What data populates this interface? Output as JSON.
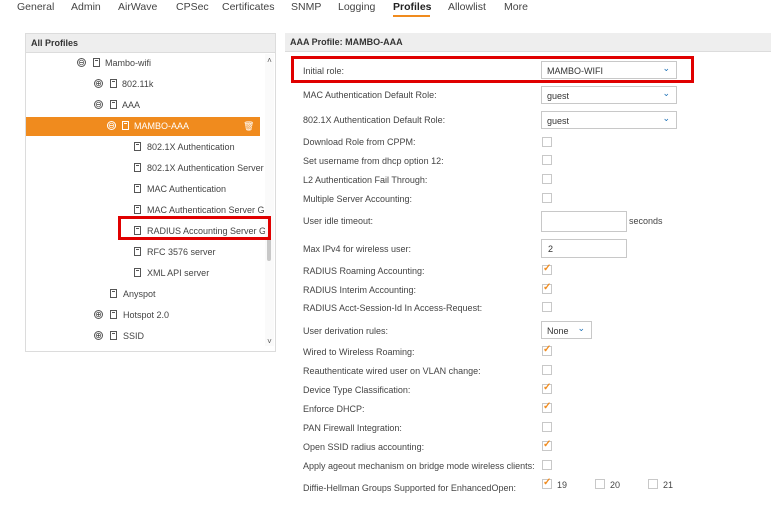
{
  "tabs": [
    "General",
    "Admin",
    "AirWave",
    "CPSec",
    "Certificates",
    "SNMP",
    "Logging",
    "Profiles",
    "Allowlist",
    "More"
  ],
  "active_tab": "Profiles",
  "left_panel": {
    "title": "All Profiles",
    "tree": [
      {
        "label": "Mambo-wifi",
        "control": "⊖"
      },
      {
        "label": "802.11k",
        "control": "⊕"
      },
      {
        "label": "AAA",
        "control": "⊖"
      },
      {
        "label": "MAMBO-AAA",
        "control": "⊖"
      },
      {
        "label": "802.1X Authentication"
      },
      {
        "label": "802.1X Authentication Server"
      },
      {
        "label": "MAC Authentication"
      },
      {
        "label": "MAC Authentication Server Gr"
      },
      {
        "label": "RADIUS Accounting Server Gr"
      },
      {
        "label": "RFC 3576 server"
      },
      {
        "label": "XML API server"
      },
      {
        "label": "Anyspot"
      },
      {
        "label": "Hotspot 2.0",
        "control": "⊕"
      },
      {
        "label": "SSID",
        "control": "⊕"
      }
    ],
    "trash_icon": "trash-icon",
    "scroll_up": "˄",
    "scroll_down": "˅"
  },
  "right_panel": {
    "title": "AAA Profile: MAMBO-AAA",
    "fields": [
      {
        "label": "Initial role:",
        "type": "select",
        "value": "MAMBO-WIFI"
      },
      {
        "label": "MAC Authentication Default Role:",
        "type": "select",
        "value": "guest"
      },
      {
        "label": "802.1X Authentication Default Role:",
        "type": "select",
        "value": "guest"
      },
      {
        "label": "Download Role from CPPM:",
        "type": "checkbox",
        "checked": false
      },
      {
        "label": "Set username from dhcp option 12:",
        "type": "checkbox",
        "checked": false
      },
      {
        "label": "L2 Authentication Fail Through:",
        "type": "checkbox",
        "checked": false
      },
      {
        "label": "Multiple Server Accounting:",
        "type": "checkbox",
        "checked": false
      },
      {
        "label": "User idle timeout:",
        "type": "text",
        "value": "",
        "suffix": "seconds"
      },
      {
        "label": "Max IPv4 for wireless user:",
        "type": "text",
        "value": "2"
      },
      {
        "label": "RADIUS Roaming Accounting:",
        "type": "checkbox",
        "checked": true
      },
      {
        "label": "RADIUS Interim Accounting:",
        "type": "checkbox",
        "checked": true
      },
      {
        "label": "RADIUS Acct-Session-Id In Access-Request:",
        "type": "checkbox",
        "checked": false
      },
      {
        "label": "User derivation rules:",
        "type": "select",
        "value": "None"
      },
      {
        "label": "Wired to Wireless Roaming:",
        "type": "checkbox",
        "checked": true
      },
      {
        "label": "Reauthenticate wired user on VLAN change:",
        "type": "checkbox",
        "checked": false
      },
      {
        "label": "Device Type Classification:",
        "type": "checkbox",
        "checked": true
      },
      {
        "label": "Enforce DHCP:",
        "type": "checkbox",
        "checked": true
      },
      {
        "label": "PAN Firewall Integration:",
        "type": "checkbox",
        "checked": false
      },
      {
        "label": "Open SSID radius accounting:",
        "type": "checkbox",
        "checked": true
      },
      {
        "label": "Apply ageout mechanism on bridge mode wireless clients:",
        "type": "checkbox",
        "checked": false
      },
      {
        "label": "Diffie-Hellman Groups Supported for EnhancedOpen:",
        "type": "multi",
        "options": [
          {
            "label": "19",
            "checked": true
          },
          {
            "label": "20",
            "checked": false
          },
          {
            "label": "21",
            "checked": false
          }
        ]
      }
    ]
  },
  "colors": {
    "accent": "#f08b1e",
    "highlight": "#e00000",
    "link": "#1a6fb5"
  }
}
